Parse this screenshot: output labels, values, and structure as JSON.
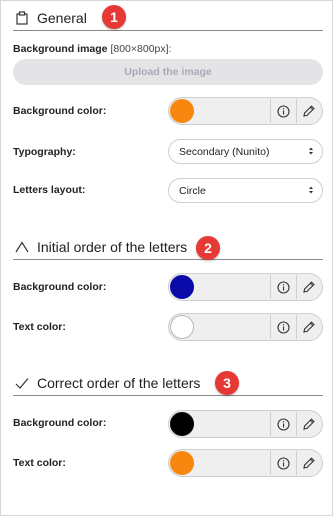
{
  "general": {
    "title": "General",
    "badge": "1",
    "background_image_label": "Background image",
    "background_image_hint": "[800×800px]:",
    "upload_label": "Upload the image",
    "background_color_label": "Background color:",
    "background_color": "#f7870f",
    "typography_label": "Typography:",
    "typography_value": "Secondary (Nunito)",
    "letters_layout_label": "Letters layout:",
    "letters_layout_value": "Circle"
  },
  "initial": {
    "title": "Initial order of the letters",
    "badge": "2",
    "background_color_label": "Background color:",
    "background_color": "#0a0aa8",
    "text_color_label": "Text color:",
    "text_color": "#ffffff"
  },
  "correct": {
    "title": "Correct order of the letters",
    "badge": "3",
    "background_color_label": "Background color:",
    "background_color": "#000000",
    "text_color_label": "Text color:",
    "text_color": "#f7870f"
  },
  "icons": {
    "general": "clipboard-icon",
    "initial": "caret-up-icon",
    "correct": "checkmark-icon",
    "info": "info-icon",
    "edit": "pencil-icon"
  },
  "accent": "#e53935"
}
